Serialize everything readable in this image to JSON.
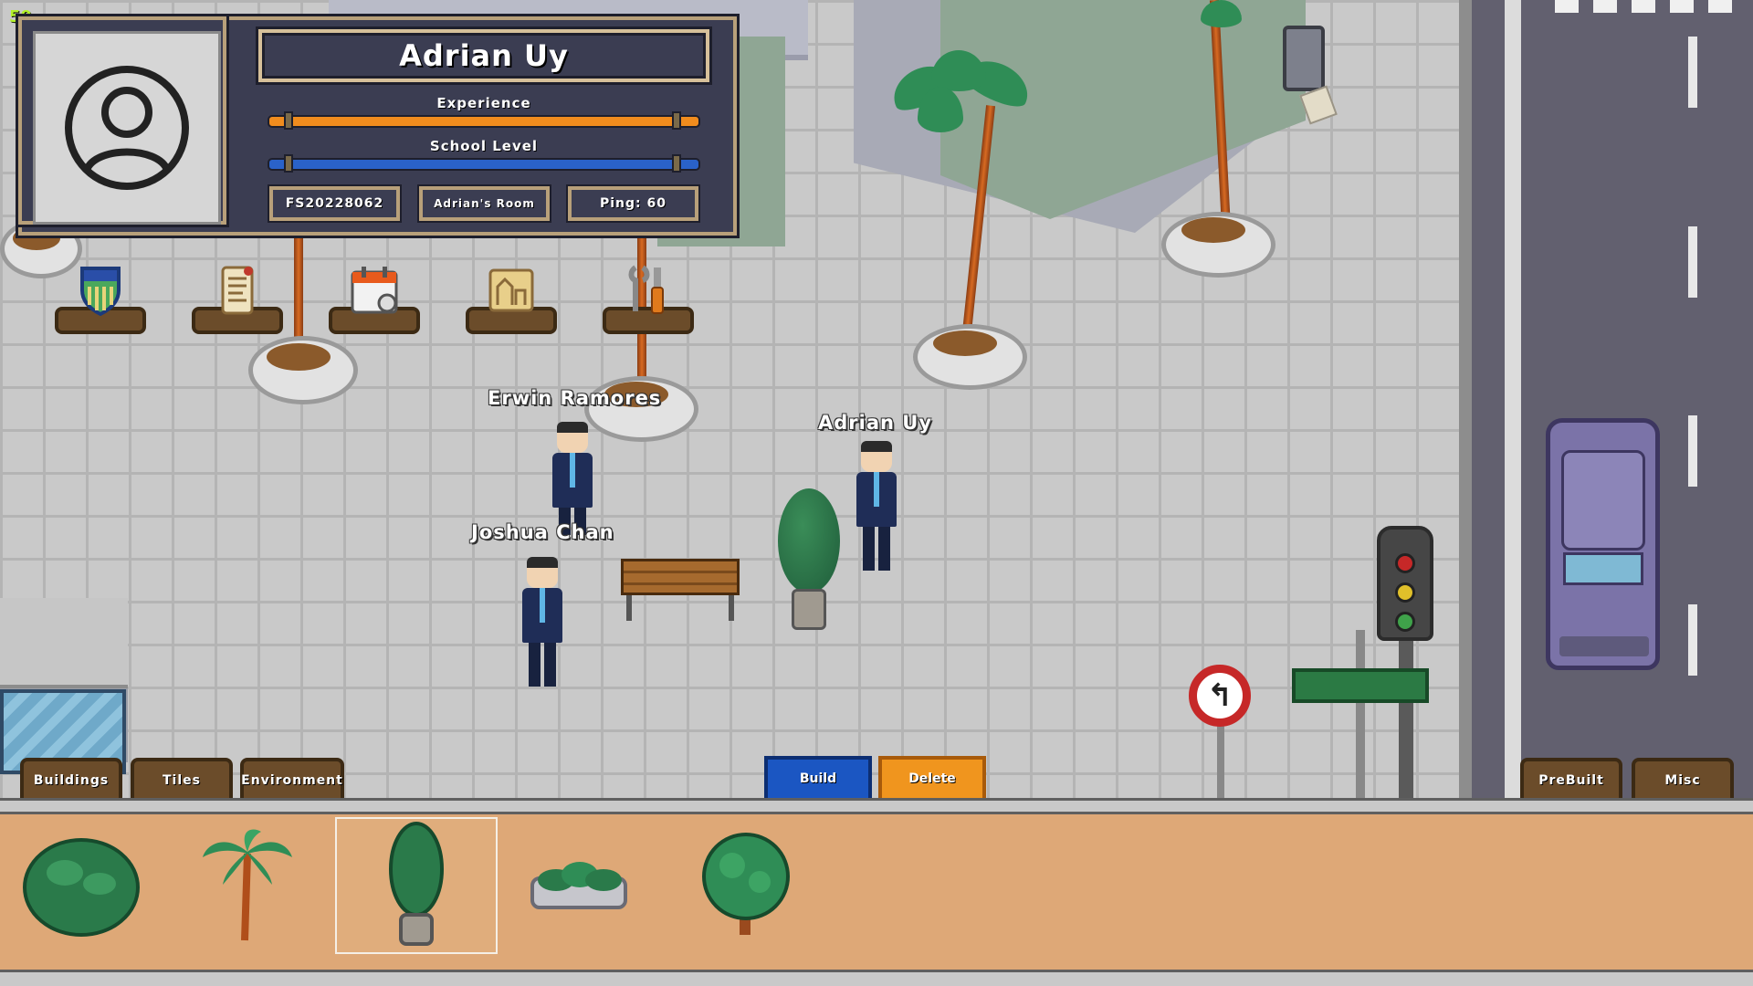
{
  "fps": "59",
  "player": {
    "name": "Adrian Uy",
    "experience_label": "Experience",
    "school_level_label": "School Level",
    "id": "FS20228062",
    "room": "Adrian's Room",
    "ping": "Ping: 60"
  },
  "menu_icons": [
    "shield-icon",
    "scroll-icon",
    "calendar-icon",
    "blueprint-icon",
    "tools-icon"
  ],
  "characters": {
    "erwin": "Erwin Ramores",
    "adrian": "Adrian Uy",
    "joshua": "Joshua Chan"
  },
  "build_tabs": {
    "buildings": "Buildings",
    "tiles": "Tiles",
    "environment": "Environment",
    "prebuilt": "PreBuilt",
    "misc": "Misc"
  },
  "mode": {
    "build": "Build",
    "delete": "Delete",
    "active": "Build"
  },
  "tray_items": [
    "round-bush",
    "palm-tree",
    "topiary-pot",
    "planter-box",
    "round-tree"
  ],
  "tray_selected": "topiary-pot",
  "colors": {
    "experience_bar": "#f08c1e",
    "school_level_bar": "#2a62c9",
    "hud_panel": "#3b3d52",
    "hud_border": "#b8a07a",
    "build_button": "#1b56c2",
    "delete_button": "#f0951e",
    "tray": "#dea877",
    "fps_text": "#b3f02a"
  }
}
